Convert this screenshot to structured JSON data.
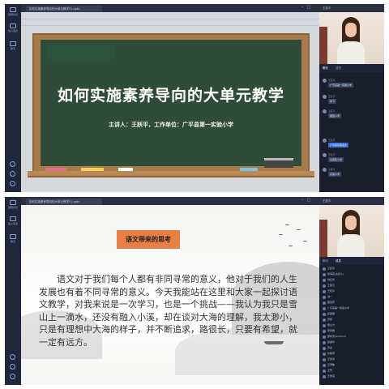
{
  "top": {
    "tab_title": "如何实施素养导向的大单元教学Y1.pptx",
    "right_header": "王跃平",
    "left_bar": [
      "屏幕共享",
      "加入会议",
      "聊天"
    ],
    "slide": {
      "title": "如何实施素养导向的大单元教学",
      "subtitle": "主讲人：王跃平，工作单位：广平县第一实验小学"
    },
    "chat_tabs": [
      "聊天",
      "成员"
    ],
    "chat": [
      {
        "name": "王跃平",
        "text": "广平县第一实验小学",
        "highlight": false
      },
      {
        "name": "王跃平",
        "text": "学习",
        "highlight": false
      },
      {
        "name": "王跃平",
        "text": "雅园小学",
        "highlight": false
      },
      {
        "name": "王跃平",
        "text": "广平县东张孟乡",
        "highlight": true
      },
      {
        "name": "王跃平",
        "text": "北街民小学",
        "highlight": false
      },
      {
        "name": "王跃平",
        "text": "实验小学",
        "highlight": false
      }
    ]
  },
  "bottom": {
    "tab_title": "如何实施素养导向的大单元教学Y1.pptx",
    "right_header": "王跃平",
    "left_bar": [
      "屏幕共享",
      "加入会议",
      "聊天"
    ],
    "slide": {
      "heading": "语文带来的思考",
      "paragraph": "语文对于我们每个人都有非同寻常的意义，他对于我们的人生发展也有着不同寻常的意义。今天我能站在这里和大家一起探讨语文教学，对我来说是一次学习，也是一个挑战——我认为我只是雪山上一滴水，还没有融入小溪，却在谈对大海的理解，我太渺小，只是有理想中大海的样子，并不断追求，路很长，只要有希望，就一定有远方。"
    },
    "member_tabs": [
      "聊天",
      "成员"
    ],
    "members": [
      "王跃平",
      "翟海燕(主持人)",
      "刘红光",
      "王丽云",
      "王晓平",
      "当一",
      "董慧芳",
      "广平县第一实验小学",
      "赵丽娟",
      "苏伟",
      "曹立力",
      "李凤霞",
      "邵利芳(Android)",
      "赵素珍",
      "苏杰",
      "刘丽萍",
      "王秀清",
      "王翠敏",
      "王雪",
      "王秀英"
    ]
  }
}
